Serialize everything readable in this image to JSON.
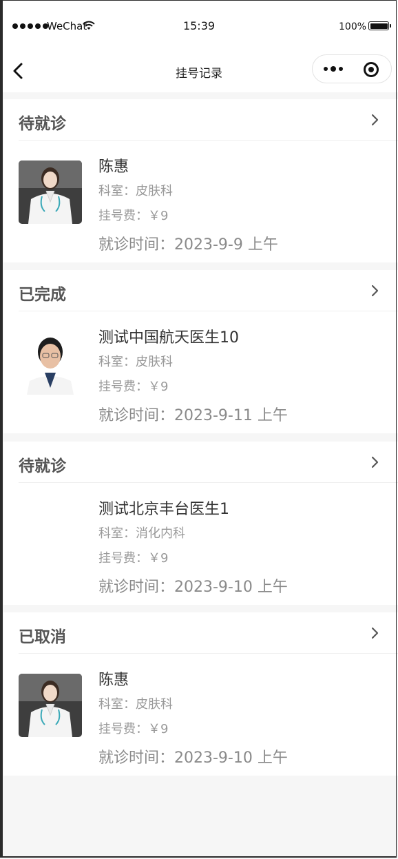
{
  "status_bar": {
    "carrier": "WeChat",
    "time": "15:39",
    "battery": "100%"
  },
  "navbar": {
    "title": "挂号记录",
    "back_icon": "back-arrow-icon",
    "more_icon": "more-dots-icon",
    "close_icon": "capsule-close-icon"
  },
  "records": [
    {
      "status": "待就诊",
      "doctor": "陈惠",
      "department": "科室：皮肤科",
      "fee": "挂号费：￥9",
      "visit_time": "就诊时间：2023-9-9 上午",
      "avatar": "female-doctor-photo"
    },
    {
      "status": "已完成",
      "doctor": "测试中国航天医生10",
      "department": "科室：皮肤科",
      "fee": "挂号费：￥9",
      "visit_time": "就诊时间：2023-9-11 上午",
      "avatar": "male-doctor-photo"
    },
    {
      "status": "待就诊",
      "doctor": "测试北京丰台医生1",
      "department": "科室：消化内科",
      "fee": "挂号费：￥9",
      "visit_time": "就诊时间：2023-9-10 上午",
      "avatar": ""
    },
    {
      "status": "已取消",
      "doctor": "陈惠",
      "department": "科室：皮肤科",
      "fee": "挂号费：￥9",
      "visit_time": "就诊时间：2023-9-10 上午",
      "avatar": "female-doctor-photo"
    }
  ]
}
